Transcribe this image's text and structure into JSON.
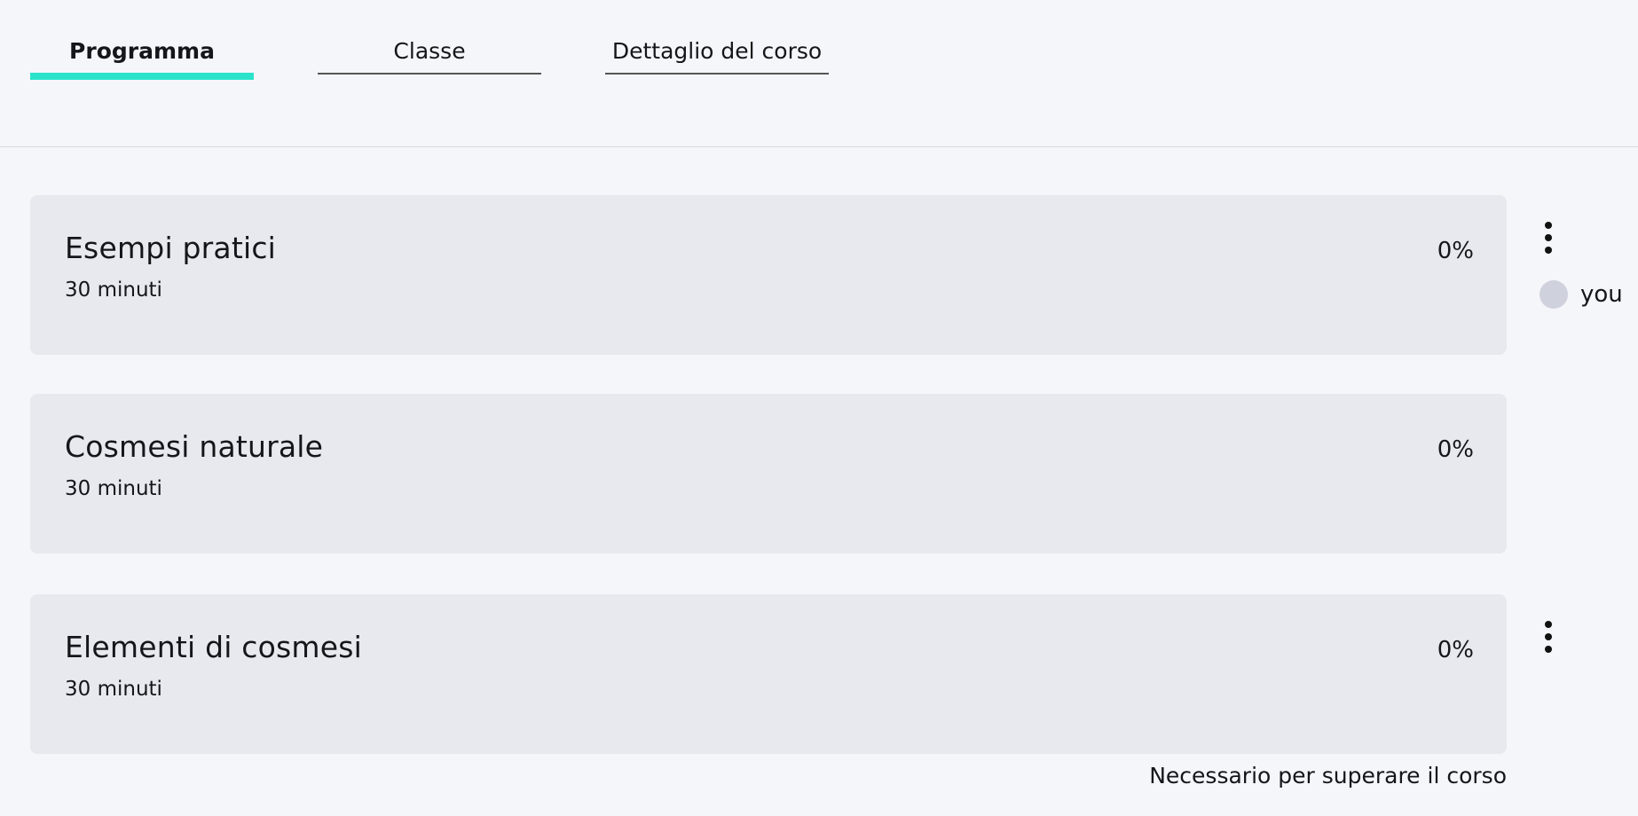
{
  "tabs": [
    {
      "label": "Programma",
      "active": true
    },
    {
      "label": "Classe",
      "active": false
    },
    {
      "label": "Dettaglio del corso",
      "active": false
    }
  ],
  "lessons": [
    {
      "title": "Esempi pratici",
      "duration": "30 minuti",
      "progress": "0%"
    },
    {
      "title": "Cosmesi naturale",
      "duration": "30 minuti",
      "progress": "0%"
    },
    {
      "title": "Elementi di cosmesi",
      "duration": "30 minuti",
      "progress": "0%"
    }
  ],
  "user": {
    "name": "you"
  },
  "footnote": "Necessario per superare il corso",
  "colors": {
    "accent": "#2be3cb",
    "card_bg": "#e8e9ee",
    "page_bg": "#f5f6fa"
  },
  "icons": {
    "menu": "more-vertical-icon",
    "avatar": "avatar"
  }
}
